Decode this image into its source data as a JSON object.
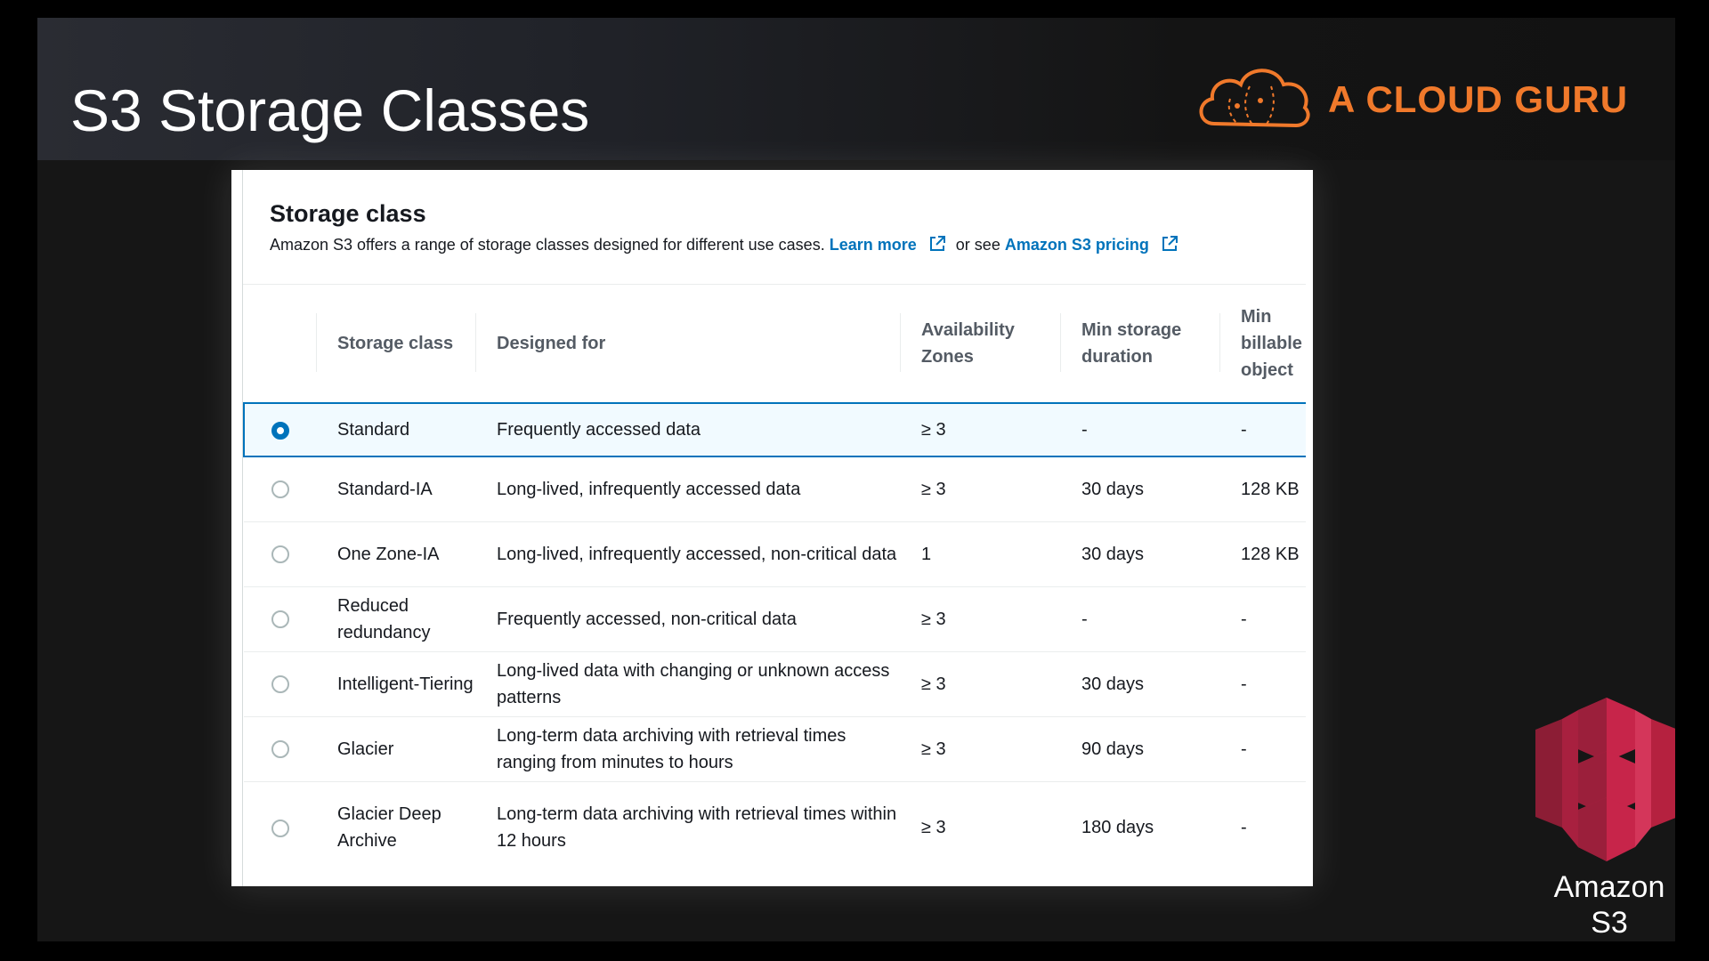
{
  "slide": {
    "title": "S3 Storage Classes",
    "brand": "A CLOUD GURU",
    "brand_color": "#f0792b",
    "corner_logo_label_line1": "Amazon",
    "corner_logo_label_line2": "S3"
  },
  "storage_class": {
    "title": "Storage class",
    "description": "Amazon S3 offers a range of storage classes designed for different use cases.",
    "learn_more_label": "Learn more",
    "or_see_text": "or see",
    "pricing_label": "Amazon S3 pricing",
    "selected": "Standard",
    "columns": {
      "storage_class": "Storage class",
      "designed_for": "Designed for",
      "availability_zones": "Availability Zones",
      "min_storage_duration": "Min storage duration",
      "min_billable_object": "Min billable object"
    },
    "rows": [
      {
        "storage_class": "Standard",
        "designed_for": "Frequently accessed data",
        "az": "≥ 3",
        "min_duration": "-",
        "min_billable": "-"
      },
      {
        "storage_class": "Standard-IA",
        "designed_for": "Long-lived, infrequently accessed data",
        "az": "≥ 3",
        "min_duration": "30 days",
        "min_billable": "128 KB"
      },
      {
        "storage_class": "One Zone-IA",
        "designed_for": "Long-lived, infrequently accessed, non-critical data",
        "az": "1",
        "min_duration": "30 days",
        "min_billable": "128 KB"
      },
      {
        "storage_class": "Reduced redundancy",
        "designed_for": "Frequently accessed, non-critical data",
        "az": "≥ 3",
        "min_duration": "-",
        "min_billable": "-"
      },
      {
        "storage_class": "Intelligent-Tiering",
        "designed_for": "Long-lived data with changing or unknown access patterns",
        "az": "≥ 3",
        "min_duration": "30 days",
        "min_billable": "-"
      },
      {
        "storage_class": "Glacier",
        "designed_for": "Long-term data archiving with retrieval times ranging from minutes to hours",
        "az": "≥ 3",
        "min_duration": "90 days",
        "min_billable": "-"
      },
      {
        "storage_class": "Glacier Deep Archive",
        "designed_for": "Long-term data archiving with retrieval times within 12 hours",
        "az": "≥ 3",
        "min_duration": "180 days",
        "min_billable": "-"
      }
    ]
  }
}
